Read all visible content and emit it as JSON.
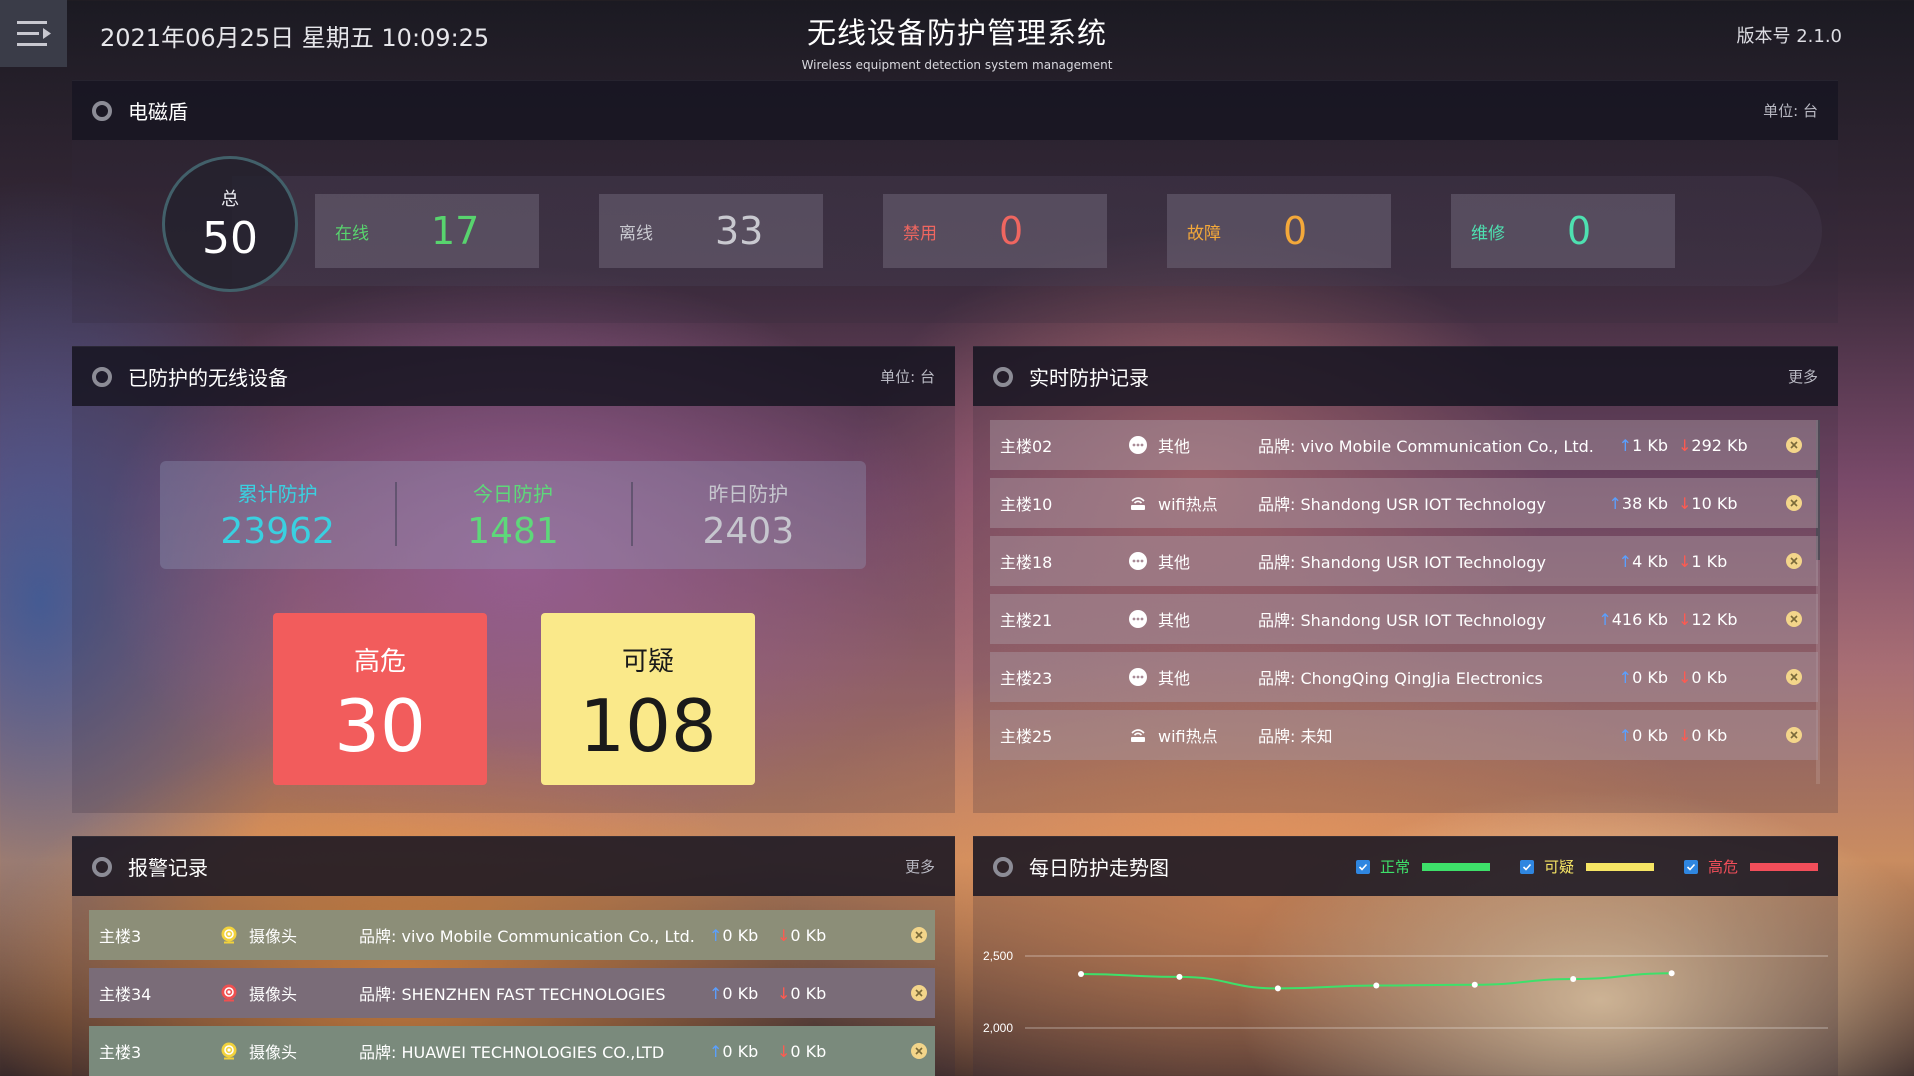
{
  "header": {
    "datetime": "2021年06月25日  星期五  10:09:25",
    "title": "无线设备防护管理系统",
    "subtitle": "Wireless equipment detection system management",
    "version": "版本号 2.1.0"
  },
  "em_shield": {
    "title": "电磁盾",
    "unit": "单位: 台",
    "total_label": "总",
    "total_value": "50",
    "stats": [
      {
        "label": "在线",
        "value": "17",
        "color": "#58d46e"
      },
      {
        "label": "离线",
        "value": "33",
        "color": "#c9c9d0"
      },
      {
        "label": "禁用",
        "value": "0",
        "color": "#ef6660"
      },
      {
        "label": "故障",
        "value": "0",
        "color": "#f3a83a"
      },
      {
        "label": "维修",
        "value": "0",
        "color": "#4ee0b0"
      }
    ]
  },
  "protected": {
    "title": "已防护的无线设备",
    "unit": "单位: 台",
    "summary": [
      {
        "label": "累计防护",
        "value": "23962",
        "color": "#3ad0e0"
      },
      {
        "label": "今日防护",
        "value": "1481",
        "color": "#5ed87a"
      },
      {
        "label": "昨日防护",
        "value": "2403",
        "color": "#c6c6ce"
      }
    ],
    "high_risk": {
      "label": "高危",
      "value": "30",
      "color": "#f25c5c"
    },
    "suspicious": {
      "label": "可疑",
      "value": "108",
      "color": "#fae98a"
    }
  },
  "realtime": {
    "title": "实时防护记录",
    "more": "更多",
    "rows": [
      {
        "loc": "主楼02",
        "type": "其他",
        "icon": "chat-bubble-icon",
        "brand": "品牌: vivo Mobile Communication Co., Ltd.",
        "up": "1 Kb",
        "down": "292 Kb"
      },
      {
        "loc": "主楼10",
        "type": "wifi热点",
        "icon": "wifi-router-icon",
        "brand": "品牌: Shandong USR IOT Technology",
        "up": "38 Kb",
        "down": "10 Kb"
      },
      {
        "loc": "主楼18",
        "type": "其他",
        "icon": "chat-bubble-icon",
        "brand": "品牌: Shandong USR IOT Technology",
        "up": "4 Kb",
        "down": "1 Kb"
      },
      {
        "loc": "主楼21",
        "type": "其他",
        "icon": "chat-bubble-icon",
        "brand": "品牌: Shandong USR IOT Technology",
        "up": "416 Kb",
        "down": "12 Kb"
      },
      {
        "loc": "主楼23",
        "type": "其他",
        "icon": "chat-bubble-icon",
        "brand": "品牌: ChongQing QingJia Electronics",
        "up": "0 Kb",
        "down": "0 Kb"
      },
      {
        "loc": "主楼25",
        "type": "wifi热点",
        "icon": "wifi-router-icon",
        "brand": "品牌: 未知",
        "up": "0 Kb",
        "down": "0 Kb"
      }
    ]
  },
  "alarms": {
    "title": "报警记录",
    "more": "更多",
    "rows": [
      {
        "loc": "主楼3",
        "type": "摄像头",
        "icon_color": "#f2d23c",
        "row_color": "#8c8e78",
        "brand": "品牌: vivo Mobile Communication Co., Ltd.",
        "up": "0 Kb",
        "down": "0 Kb"
      },
      {
        "loc": "主楼34",
        "type": "摄像头",
        "icon_color": "#ef5050",
        "row_color": "#7a6c78",
        "brand": "品牌: SHENZHEN FAST TECHNOLOGIES",
        "up": "0 Kb",
        "down": "0 Kb"
      },
      {
        "loc": "主楼3",
        "type": "摄像头",
        "icon_color": "#f2d23c",
        "row_color": "#7a8a7c",
        "brand": "品牌: HUAWEI TECHNOLOGIES CO.,LTD",
        "up": "0 Kb",
        "down": "0 Kb"
      }
    ]
  },
  "trend": {
    "title": "每日防护走势图",
    "legend": [
      {
        "label": "正常",
        "color": "#3ee06a"
      },
      {
        "label": "可疑",
        "color": "#f6e564"
      },
      {
        "label": "高危",
        "color": "#f24e5a"
      }
    ]
  },
  "chart_data": {
    "type": "line",
    "title": "每日防护走势图",
    "y_ticks": [
      "2,500",
      "2,000"
    ],
    "ylim": [
      2000,
      2500
    ],
    "series": [
      {
        "name": "正常",
        "color": "#3ee06a",
        "values": [
          2375,
          2355,
          2275,
          2295,
          2300,
          2340,
          2380
        ]
      }
    ],
    "legend_position": "top-right",
    "grid": true
  }
}
